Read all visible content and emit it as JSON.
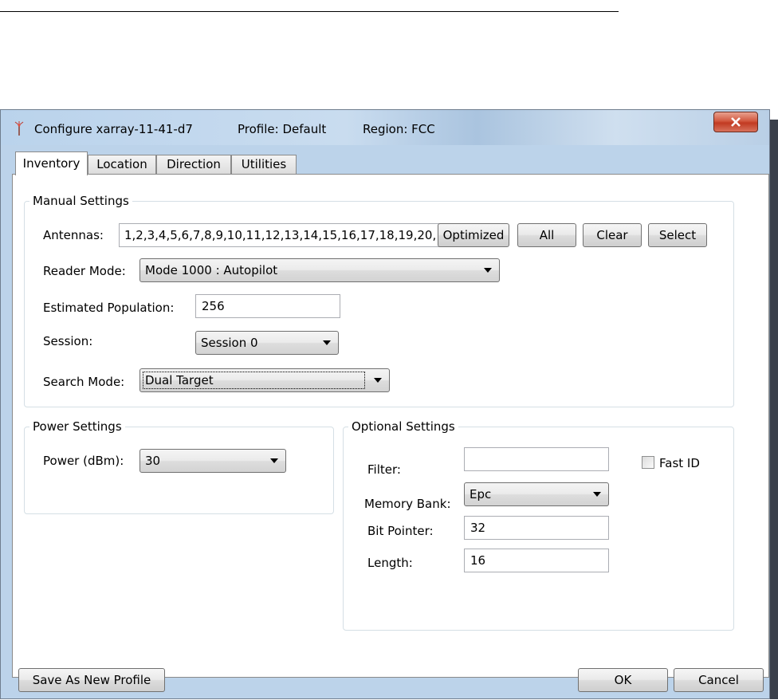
{
  "window": {
    "title": "Configure xarray-11-41-d7",
    "profile": "Profile: Default",
    "region": "Region: FCC"
  },
  "tabs": [
    {
      "label": "Inventory",
      "active": true
    },
    {
      "label": "Location",
      "active": false
    },
    {
      "label": "Direction",
      "active": false
    },
    {
      "label": "Utilities",
      "active": false
    }
  ],
  "manual": {
    "legend": "Manual Settings",
    "antennas_label": "Antennas:",
    "antennas_value": "1,2,3,4,5,6,7,8,9,10,11,12,13,14,15,16,17,18,19,20,",
    "buttons": {
      "optimized": "Optimized",
      "all": "All",
      "clear": "Clear",
      "select": "Select"
    },
    "reader_mode_label": "Reader Mode:",
    "reader_mode_value": "Mode 1000 : Autopilot",
    "population_label": "Estimated Population:",
    "population_value": "256",
    "session_label": "Session:",
    "session_value": "Session 0",
    "search_mode_label": "Search Mode:",
    "search_mode_value": "Dual Target"
  },
  "power": {
    "legend": "Power Settings",
    "label": "Power (dBm):",
    "value": "30"
  },
  "optional": {
    "legend": "Optional Settings",
    "filter_label": "Filter:",
    "filter_value": "",
    "fast_id_label": "Fast ID",
    "fast_id_checked": false,
    "memory_bank_label": "Memory Bank:",
    "memory_bank_value": "Epc",
    "bit_pointer_label": "Bit Pointer:",
    "bit_pointer_value": "32",
    "length_label": "Length:",
    "length_value": "16"
  },
  "footer": {
    "save_profile": "Save As New Profile",
    "ok": "OK",
    "cancel": "Cancel"
  },
  "colors": {
    "titlebar": "#bcd3ea",
    "close_button": "#c94a32",
    "group_border": "#d5dfe5"
  }
}
